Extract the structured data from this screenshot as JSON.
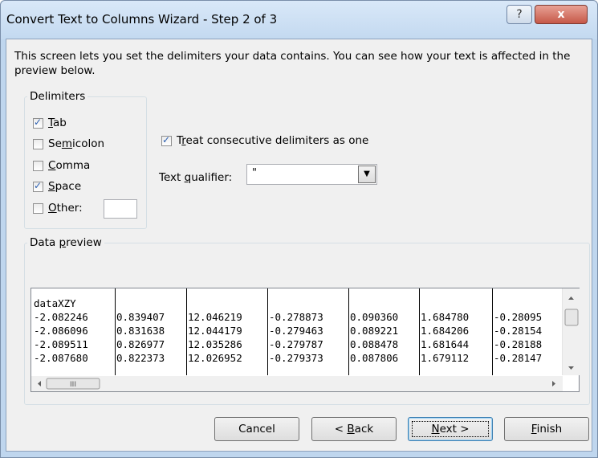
{
  "window": {
    "title": "Convert Text to Columns Wizard - Step 2 of 3",
    "help_glyph": "?",
    "close_glyph": "x"
  },
  "description": "This screen lets you set the delimiters your data contains.  You can see how your text is affected in the preview below.",
  "delimiters": {
    "group_label": "Delimiters",
    "items": [
      {
        "label_pre": "",
        "label_u": "T",
        "label_post": "ab",
        "checked": true
      },
      {
        "label_pre": "Se",
        "label_u": "m",
        "label_post": "icolon",
        "checked": false
      },
      {
        "label_pre": "",
        "label_u": "C",
        "label_post": "omma",
        "checked": false
      },
      {
        "label_pre": "",
        "label_u": "S",
        "label_post": "pace",
        "checked": true
      },
      {
        "label_pre": "",
        "label_u": "O",
        "label_post": "ther:",
        "checked": false
      }
    ],
    "other_value": ""
  },
  "consecutive": {
    "label_pre": "T",
    "label_u": "r",
    "label_post": "eat consecutive delimiters as one",
    "checked": true
  },
  "qualifier": {
    "label_pre": "Text ",
    "label_u": "q",
    "label_post": "ualifier:",
    "value": "\""
  },
  "preview": {
    "group_label_pre": "Data ",
    "group_label_u": "p",
    "group_label_post": "review",
    "rows": [
      [
        "dataXZY",
        "",
        "",
        "",
        "",
        "",
        ""
      ],
      [
        "-2.082246",
        "0.839407",
        "12.046219",
        "-0.278873",
        "0.090360",
        "1.684780",
        "-0.28095"
      ],
      [
        "-2.086096",
        "0.831638",
        "12.044179",
        "-0.279463",
        "0.089221",
        "1.684206",
        "-0.28154"
      ],
      [
        "-2.089511",
        "0.826977",
        "12.035286",
        "-0.279787",
        "0.088478",
        "1.681644",
        "-0.28188"
      ],
      [
        "-2.087680",
        "0.822373",
        "12.026952",
        "-0.279373",
        "0.087806",
        "1.679112",
        "-0.28147"
      ]
    ],
    "hscroll_thumb_glyph": "III"
  },
  "buttons": {
    "cancel": "Cancel",
    "back_pre": "< ",
    "back_u": "B",
    "back_post": "ack",
    "next_pre": "",
    "next_u": "N",
    "next_post": "ext >",
    "finish_pre": "",
    "finish_u": "F",
    "finish_post": "inish"
  }
}
